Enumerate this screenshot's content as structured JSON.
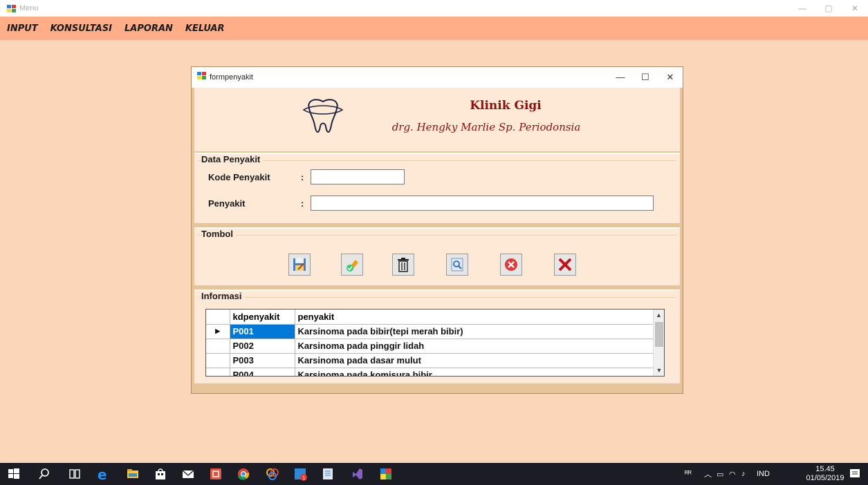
{
  "window": {
    "title": "Menu",
    "controls": [
      "—",
      "▢",
      "✕"
    ]
  },
  "menu": {
    "items": [
      "INPUT",
      "KONSULTASI",
      "LAPORAN",
      "KELUAR"
    ]
  },
  "form": {
    "title": "formpenyakit",
    "controls": [
      "—",
      "☐",
      "✕"
    ],
    "clinic_name": "Klinik Gigi",
    "doctor_name": "drg. Hengky Marlie Sp. Periodonsia",
    "data_group": {
      "title": "Data Penyakit",
      "kode_label": "Kode Penyakit",
      "kode_value": "",
      "penyakit_label": "Penyakit",
      "penyakit_value": "",
      "colon": ":"
    },
    "tombol_group": {
      "title": "Tombol"
    },
    "info_group": {
      "title": "Informasi",
      "columns": [
        "kdpenyakit",
        "penyakit"
      ],
      "rows": [
        {
          "kd": "P001",
          "penyakit": "Karsinoma pada bibir(tepi merah bibir)"
        },
        {
          "kd": "P002",
          "penyakit": "Karsinoma pada pinggir lidah"
        },
        {
          "kd": "P003",
          "penyakit": "Karsinoma pada dasar mulut"
        },
        {
          "kd": "P004",
          "penyakit": "Karsinoma pada komisura bibir"
        }
      ]
    }
  },
  "taskbar": {
    "language": "IND",
    "time": "15.45",
    "date": "01/05/2019"
  }
}
